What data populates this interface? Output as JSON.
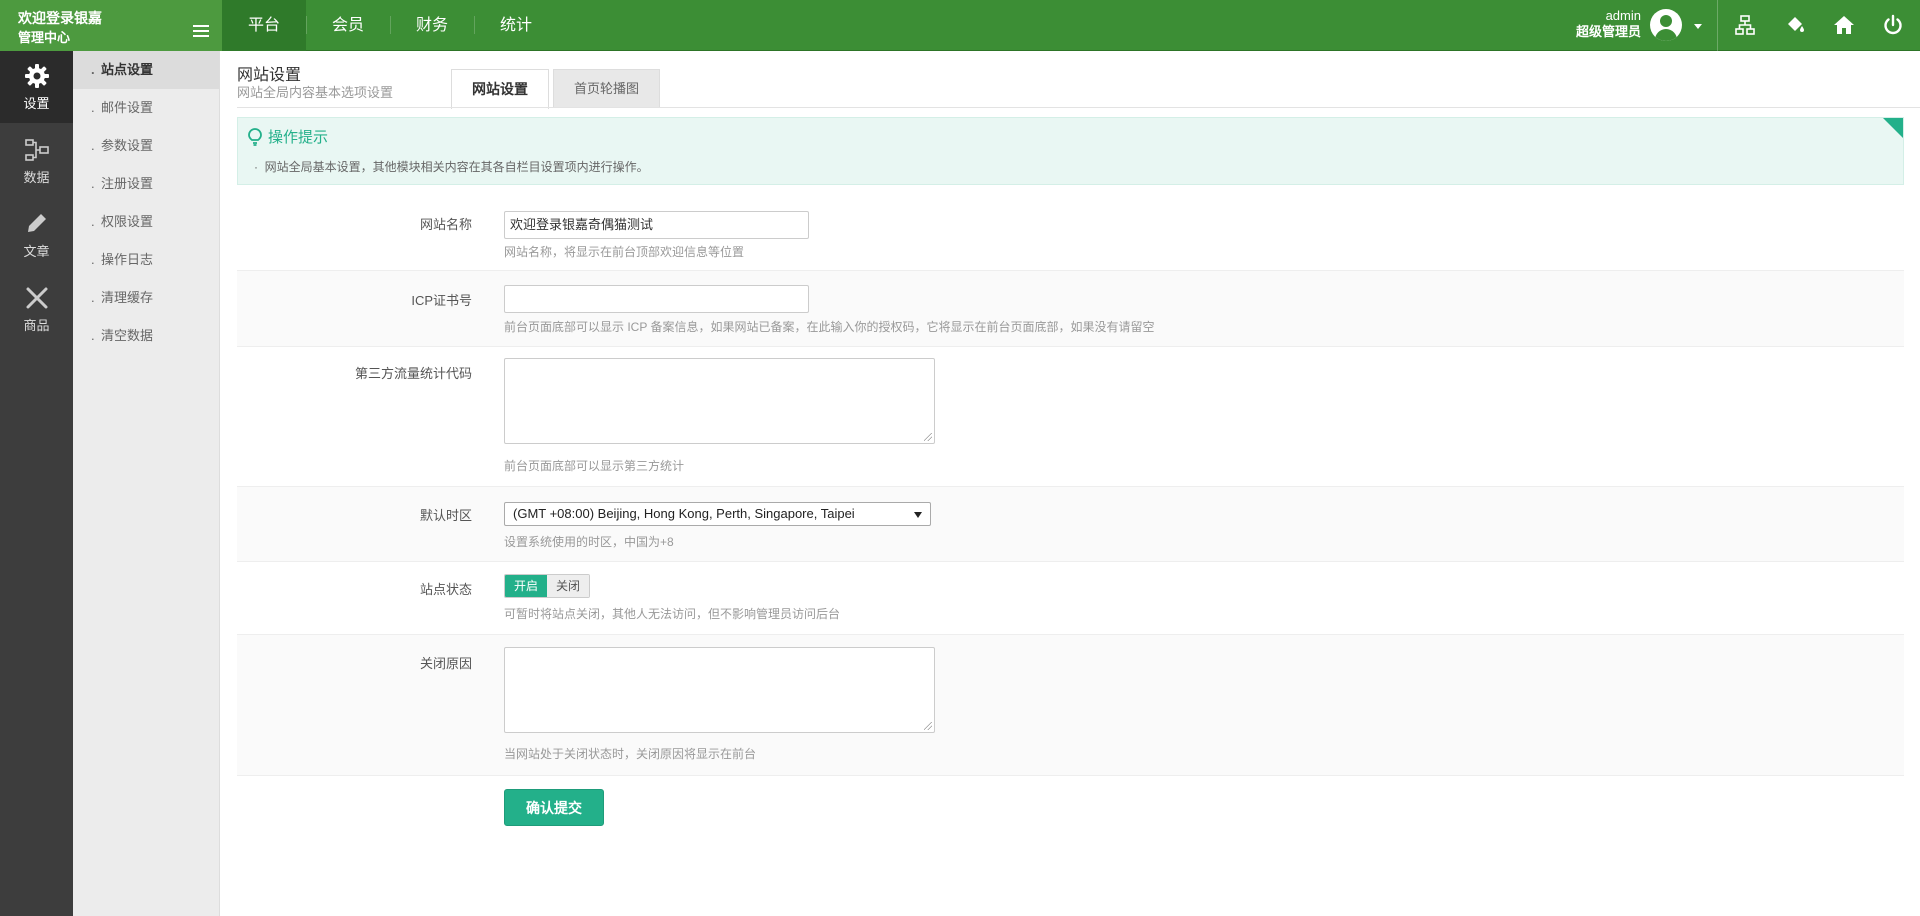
{
  "brand": {
    "line1": "欢迎登录银嘉",
    "line2": "管理中心"
  },
  "nav": [
    {
      "label": "平台",
      "active": true
    },
    {
      "label": "会员"
    },
    {
      "label": "财务"
    },
    {
      "label": "统计"
    }
  ],
  "user": {
    "name": "admin",
    "role": "超级管理员"
  },
  "top_icons": [
    "sitemap-icon",
    "paint-bucket-icon",
    "home-icon",
    "power-icon"
  ],
  "iconbar": [
    {
      "label": "设置",
      "icon": "gear-icon",
      "active": true
    },
    {
      "label": "数据",
      "icon": "sitemap-icon"
    },
    {
      "label": "文章",
      "icon": "pencil-icon"
    },
    {
      "label": "商品",
      "icon": "tools-icon"
    }
  ],
  "submenu": [
    {
      "label": "站点设置",
      "active": true
    },
    {
      "label": "邮件设置"
    },
    {
      "label": "参数设置"
    },
    {
      "label": "注册设置"
    },
    {
      "label": "权限设置"
    },
    {
      "label": "操作日志"
    },
    {
      "label": "清理缓存"
    },
    {
      "label": "清空数据"
    }
  ],
  "page": {
    "title": "网站设置",
    "subtitle": "网站全局内容基本选项设置",
    "tabs": [
      {
        "label": "网站设置",
        "active": true
      },
      {
        "label": "首页轮播图"
      }
    ]
  },
  "tip": {
    "title": "操作提示",
    "item": "网站全局基本设置，其他模块相关内容在其各自栏目设置项内进行操作。"
  },
  "form": {
    "site_name": {
      "label": "网站名称",
      "value": "欢迎登录银嘉奇偶猫测试",
      "hint": "网站名称，将显示在前台顶部欢迎信息等位置"
    },
    "icp": {
      "label": "ICP证书号",
      "value": "",
      "hint": "前台页面底部可以显示 ICP 备案信息，如果网站已备案，在此输入你的授权码，它将显示在前台页面底部，如果没有请留空"
    },
    "stats_code": {
      "label": "第三方流量统计代码",
      "hint": "前台页面底部可以显示第三方统计"
    },
    "timezone": {
      "label": "默认时区",
      "value": "(GMT +08:00) Beijing, Hong Kong, Perth, Singapore, Taipei",
      "hint": "设置系统使用的时区，中国为+8"
    },
    "site_status": {
      "label": "站点状态",
      "on": "开启",
      "off": "关闭",
      "hint": "可暂时将站点关闭，其他人无法访问，但不影响管理员访问后台"
    },
    "close_reason": {
      "label": "关闭原因",
      "hint": "当网站处于关闭状态时，关闭原因将显示在前台"
    },
    "submit": "确认提交"
  },
  "colors": {
    "topbar": "#3c8e35",
    "accent": "#23b08a",
    "sidebar": "#3d3d3d"
  }
}
